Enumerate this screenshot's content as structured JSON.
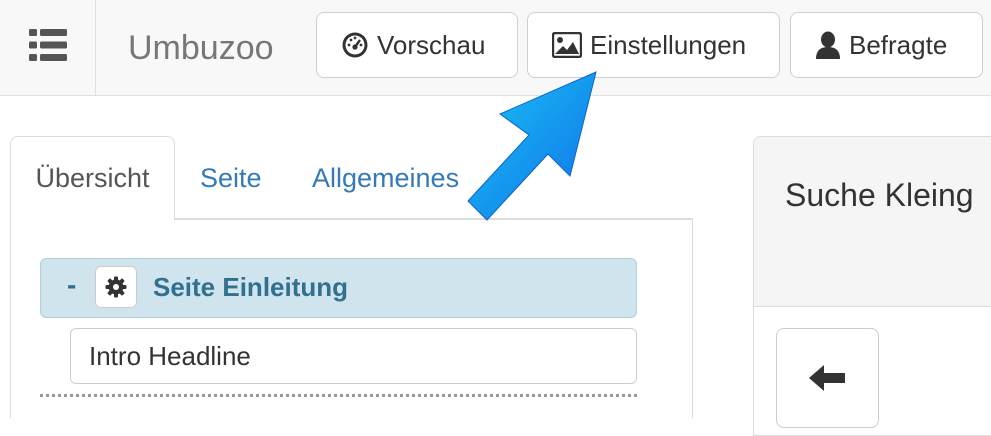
{
  "header": {
    "brand": "Umbuzoo",
    "buttons": [
      {
        "label": "Vorschau",
        "icon": "dashboard-icon"
      },
      {
        "label": "Einstellungen",
        "icon": "image-icon"
      },
      {
        "label": "Befragte",
        "icon": "user-icon"
      }
    ]
  },
  "tabs": [
    {
      "label": "Übersicht",
      "active": true
    },
    {
      "label": "Seite",
      "active": false
    },
    {
      "label": "Allgemeines",
      "active": false
    }
  ],
  "outline": {
    "page_toggle": "-",
    "page_title": "Seite Einleitung",
    "items": [
      "Intro Headline"
    ]
  },
  "preview": {
    "title": "Suche Kleing"
  },
  "colors": {
    "accent_arrow": "#1e8fe6",
    "link": "#337ab7",
    "page_row_bg": "#d0e4ee",
    "page_row_text": "#31708f"
  }
}
